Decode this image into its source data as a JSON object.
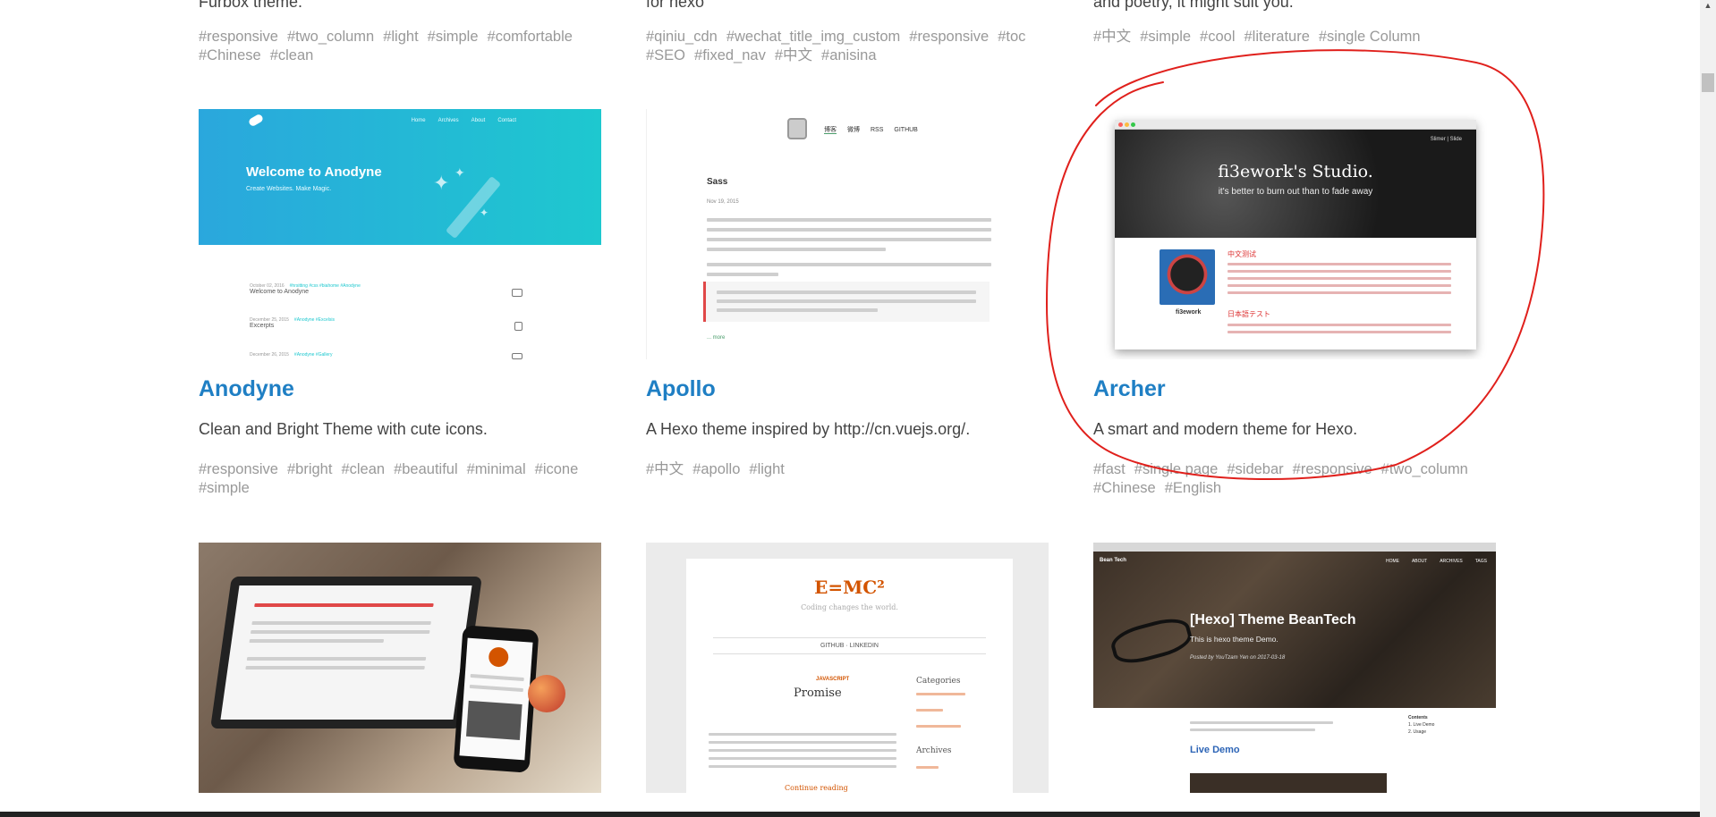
{
  "top_row": [
    {
      "desc": "Furbox theme.",
      "tags": [
        "#responsive",
        "#two_column",
        "#light",
        "#simple",
        "#comfortable",
        "#Chinese",
        "#clean"
      ]
    },
    {
      "desc": "for hexo",
      "tags": [
        "#qiniu_cdn",
        "#wechat_title_img_custom",
        "#responsive",
        "#toc",
        "#SEO",
        "#fixed_nav",
        "#中文",
        "#anisina"
      ]
    },
    {
      "desc": "and poetry, it might suit you.",
      "tags": [
        "#中文",
        "#simple",
        "#cool",
        "#literature",
        "#single Column"
      ]
    }
  ],
  "cards": [
    {
      "title": "Anodyne",
      "desc": "Clean and Bright Theme with cute icons.",
      "tags": [
        "#responsive",
        "#bright",
        "#clean",
        "#beautiful",
        "#minimal",
        "#icone",
        "#simple"
      ],
      "thumb": {
        "nav": [
          "Home",
          "Archives",
          "About",
          "Contact"
        ],
        "heading": "Welcome to Anodyne",
        "sub": "Create Websites. Make Magic.",
        "posts": [
          {
            "date": "October 02, 2016",
            "tags": "#hrsitting #css #biahome #Anodyne",
            "title": "Welcome to Anodyne"
          },
          {
            "date": "December 25, 2015",
            "tags": "#Anodyne #Excelsis",
            "title": "Excerpts"
          },
          {
            "date": "December 26, 2015",
            "tags": "#Anodyne #Gallery",
            "title": ""
          }
        ]
      }
    },
    {
      "title": "Apollo",
      "desc": "A Hexo theme inspired by http://cn.vuejs.org/.",
      "tags": [
        "#中文",
        "#apollo",
        "#light"
      ],
      "thumb": {
        "nav": [
          "博客",
          "微博",
          "RSS",
          "GITHUB"
        ],
        "post_title": "Sass",
        "date": "Nov 19, 2015",
        "more": "... more"
      }
    },
    {
      "title": "Archer",
      "desc": "A smart and modern theme for Hexo.",
      "tags": [
        "#fast",
        "#single page",
        "#sidebar",
        "#responsive",
        "#two_column",
        "#Chinese",
        "#English"
      ],
      "thumb": {
        "heading": "fi3ework's Studio.",
        "sub": "it's better to burn out than to fade away",
        "menu": "Slimer | Slide",
        "name": "fi3ework",
        "section1": "中文测试",
        "section2": "日本語テスト"
      }
    }
  ],
  "row3": {
    "emc": {
      "heading": "E=MC²",
      "sub": "Coding changes the world.",
      "nav": "GITHUB  ·  LINKEDIN",
      "category": "JAVASCRIPT",
      "post_title": "Promise",
      "side1": "Categories",
      "side2": "Archives",
      "read": "Continue reading"
    },
    "bean": {
      "brand": "Bean Tech",
      "nav": [
        "HOME",
        "ABOUT",
        "ARCHIVES",
        "TAGS"
      ],
      "heading": "[Hexo] Theme BeanTech",
      "sub": "This is hexo theme Demo.",
      "by": "Posted by YouTzam Yen on 2017-03-18",
      "live": "Live Demo",
      "toc": [
        "Contents",
        "1. Live Demo",
        "2. Usage"
      ]
    }
  },
  "colors": {
    "title_link": "#1f7fc4",
    "tag": "#999999",
    "annotation": "#e0201c"
  }
}
